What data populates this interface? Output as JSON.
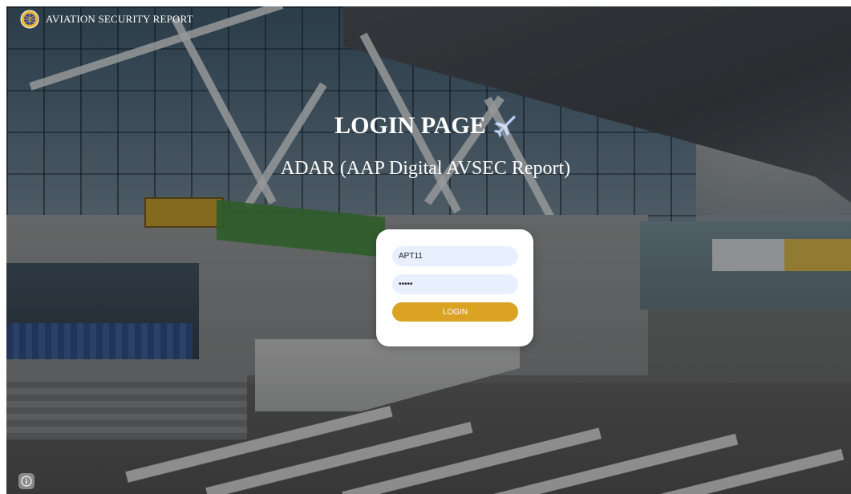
{
  "header": {
    "brand_title": "AVIATION SECURITY REPORT",
    "logo_icon": "aviation-emblem-icon"
  },
  "hero": {
    "title": "LOGIN PAGE",
    "title_icon": "airplane-icon",
    "subtitle": "ADAR (AAP Digital AVSEC Report)"
  },
  "login_form": {
    "username_value": "APT11",
    "password_value": "APT11",
    "button_label": "LOGIN"
  },
  "footer": {
    "info_icon": "info-icon"
  },
  "colors": {
    "accent": "#dba324",
    "input_background": "#e8f0fe",
    "card_background": "#ffffff",
    "text_light": "#ffffff"
  }
}
